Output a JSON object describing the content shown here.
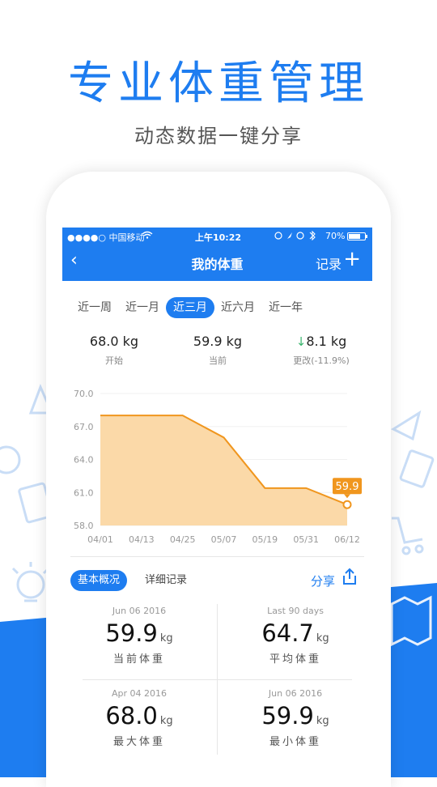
{
  "promo": {
    "headline": "专业体重管理",
    "subline": "动态数据一键分享"
  },
  "status_bar": {
    "carrier": "●●●●○ 中国移动",
    "time": "上午10:22",
    "battery": "70%"
  },
  "nav": {
    "back": "‹",
    "title": "我的体重",
    "record": "记录",
    "plus": "+"
  },
  "tabs": [
    "近一周",
    "近一月",
    "近三月",
    "近六月",
    "近一年"
  ],
  "active_tab": "近三月",
  "stats": {
    "start": {
      "value": "68.0 kg",
      "label": "开始"
    },
    "current": {
      "value": "59.9 kg",
      "label": "当前"
    },
    "change": {
      "arrow": "↓",
      "value": "8.1 kg",
      "label": "更改(-11.9%)"
    }
  },
  "chart_data": {
    "type": "area",
    "x": [
      "04/01",
      "04/13",
      "04/25",
      "05/07",
      "05/19",
      "05/31",
      "06/12"
    ],
    "yticks": [
      "70.0",
      "67.0",
      "64.0",
      "61.0",
      "58.0"
    ],
    "ylim": [
      58.0,
      70.0
    ],
    "series": [
      {
        "points": [
          [
            0,
            68.0
          ],
          [
            1,
            68.0
          ],
          [
            2,
            68.0
          ],
          [
            3,
            66.0
          ],
          [
            4,
            61.4
          ],
          [
            5,
            61.4
          ],
          [
            6,
            59.9
          ]
        ]
      }
    ],
    "last_label": "59.9",
    "line_color": "#f0961e",
    "fill_color": "#fbd9a8"
  },
  "summary": {
    "tab_basic": "基本概况",
    "tab_detail": "详细记录",
    "share": "分享",
    "cells": [
      {
        "date": "Jun 06 2016",
        "value": "59.9",
        "unit": "kg",
        "label": "当前体重"
      },
      {
        "date": "Last 90 days",
        "value": "64.7",
        "unit": "kg",
        "label": "平均体重"
      },
      {
        "date": "Apr 04 2016",
        "value": "68.0",
        "unit": "kg",
        "label": "最大体重"
      },
      {
        "date": "Jun 06 2016",
        "value": "59.9",
        "unit": "kg",
        "label": "最小体重"
      }
    ]
  },
  "colors": {
    "brand": "#1e7df0",
    "line": "#f0961e",
    "fill": "#fbd9a8",
    "down": "#3bb56e"
  }
}
